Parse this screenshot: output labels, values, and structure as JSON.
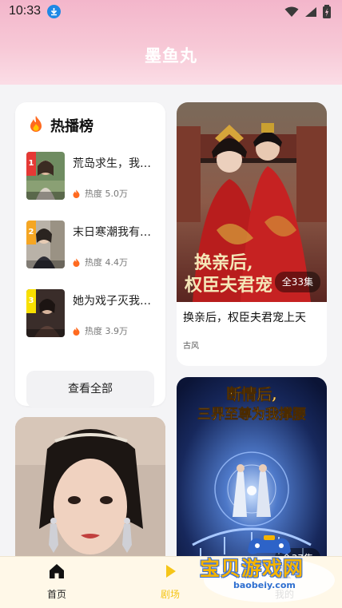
{
  "status_bar": {
    "time": "10:33"
  },
  "header": {
    "title": "墨鱼丸"
  },
  "hot_list": {
    "title": "热播榜",
    "items": [
      {
        "rank": "1",
        "name": "荒岛求生，我…",
        "heat": "热度 5.0万",
        "badge_color": "#e53935"
      },
      {
        "rank": "2",
        "name": "末日寒潮我有…",
        "heat": "热度 4.4万",
        "badge_color": "#f5a623"
      },
      {
        "rank": "3",
        "name": "她为戏子灭我…",
        "heat": "热度 3.9万",
        "badge_color": "#f8e000"
      }
    ],
    "see_all_label": "查看全部"
  },
  "dramas": [
    {
      "poster_title_line1": "换亲后,",
      "poster_title_line2": "权臣夫君宠",
      "episodes": "全33集",
      "title": "换亲后，权臣夫君宠上天",
      "tag": "古风"
    },
    {
      "poster_title_line1": "断情后,",
      "poster_title_line2": "三界至尊为我撑腰",
      "episodes": "全37集"
    }
  ],
  "bottom_nav": {
    "items": [
      {
        "label": "首页",
        "icon": "home-icon",
        "active": false
      },
      {
        "label": "剧场",
        "icon": "play-icon",
        "active": true
      },
      {
        "label": "我的",
        "icon": "user-icon",
        "active": false
      }
    ]
  },
  "watermark": {
    "text": "宝贝游戏网",
    "url": "baobeiy.com"
  },
  "colors": {
    "accent": "#f5c518",
    "header_pink": "#f7c8d6"
  }
}
